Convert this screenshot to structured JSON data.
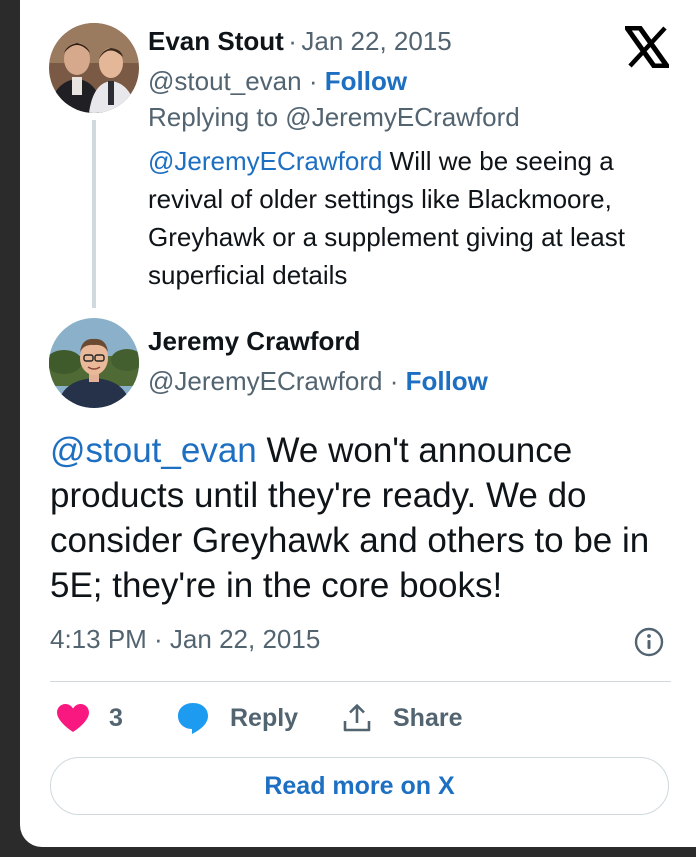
{
  "reply_tweet": {
    "author_name": "Evan Stout",
    "separator": "·",
    "date": "Jan 22, 2015",
    "handle": "@stout_evan",
    "follow_label": "Follow",
    "replying_to": "Replying to @JeremyECrawford",
    "mention": "@JeremyECrawford",
    "text": " Will we be seeing a revival of older settings like Blackmoore, Greyhawk or a supplement giving at least superficial details"
  },
  "main_tweet": {
    "author_name": "Jeremy Crawford",
    "handle": "@JeremyECrawford",
    "separator": "·",
    "follow_label": "Follow",
    "mention": "@stout_evan",
    "text": " We won't announce products until they're ready. We do consider Greyhawk and others to be in 5E; they're in the core books!",
    "timestamp": "4:13 PM · Jan 22, 2015"
  },
  "actions": {
    "like_count": "3",
    "reply_label": "Reply",
    "share_label": "Share"
  },
  "read_more_label": "Read more on X",
  "icons": {
    "logo": "x-logo-icon",
    "info": "info-icon",
    "like": "heart-icon",
    "reply": "speech-bubble-icon",
    "share": "share-upload-icon"
  },
  "colors": {
    "link": "#1d6fc2",
    "heart": "#f91880",
    "reply_bubble": "#1d9bf0",
    "muted_text": "#536471",
    "text": "#0f1419",
    "border": "#cfd9de"
  }
}
